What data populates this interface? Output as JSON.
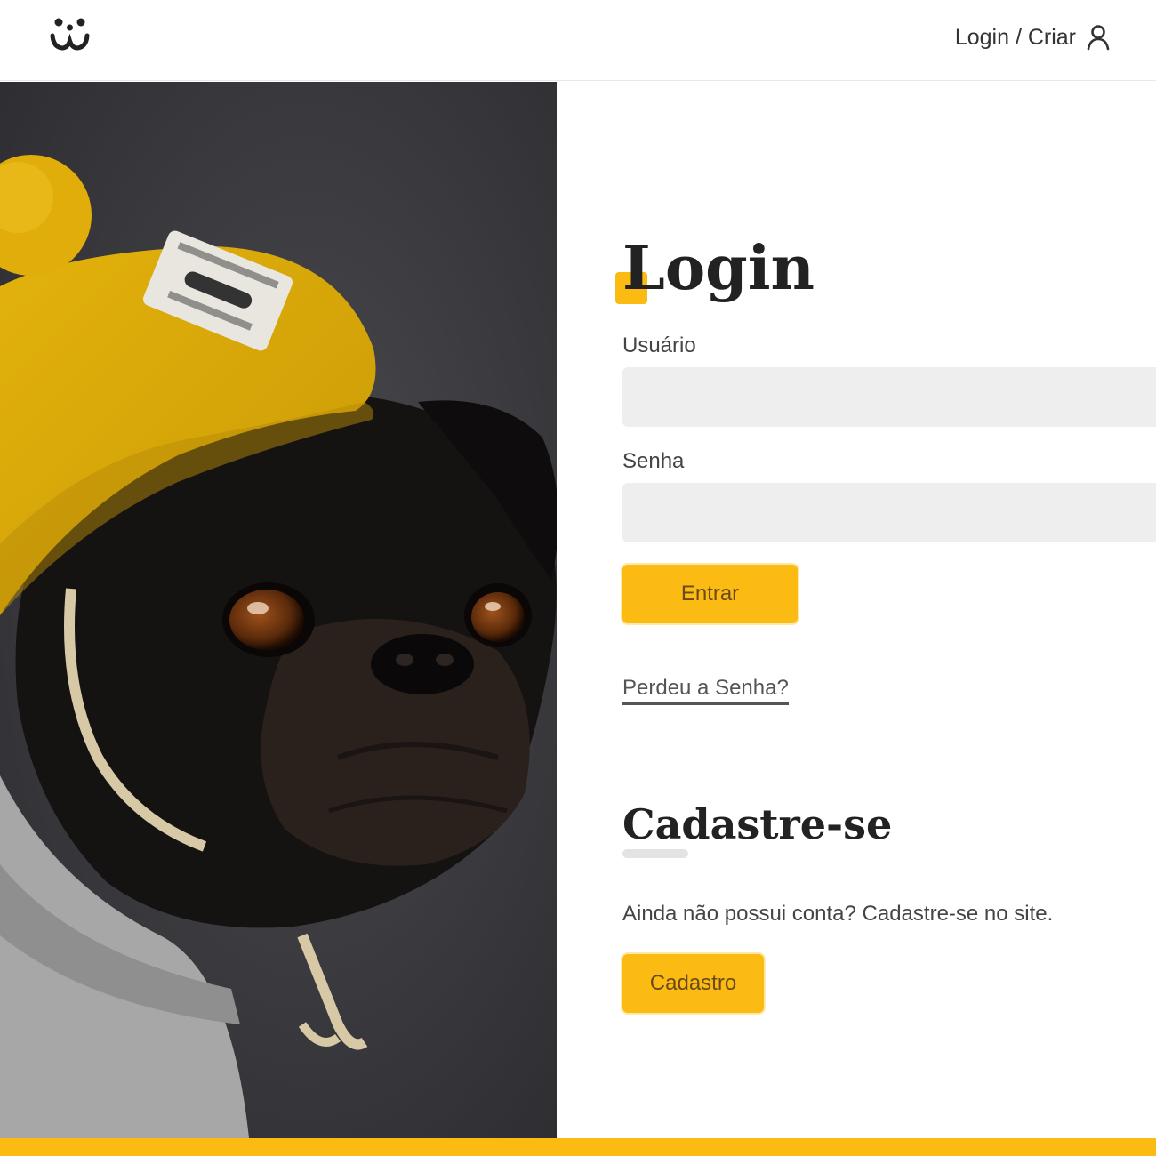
{
  "header": {
    "logo_icon": "dog-face-logo-icon",
    "login_link_label": "Login / Criar",
    "login_link_icon": "user-icon"
  },
  "login": {
    "title": "Login",
    "username_label": "Usuário",
    "username_value": "",
    "password_label": "Senha",
    "password_value": "",
    "submit_label": "Entrar",
    "lost_password_label": "Perdeu a Senha?"
  },
  "signup": {
    "title": "Cadastre-se",
    "text": "Ainda não possui conta? Cadastre-se no site.",
    "button_label": "Cadastro"
  },
  "colors": {
    "accent": "#fbbb12",
    "input_bg": "#eeeeee",
    "text": "#333333"
  }
}
